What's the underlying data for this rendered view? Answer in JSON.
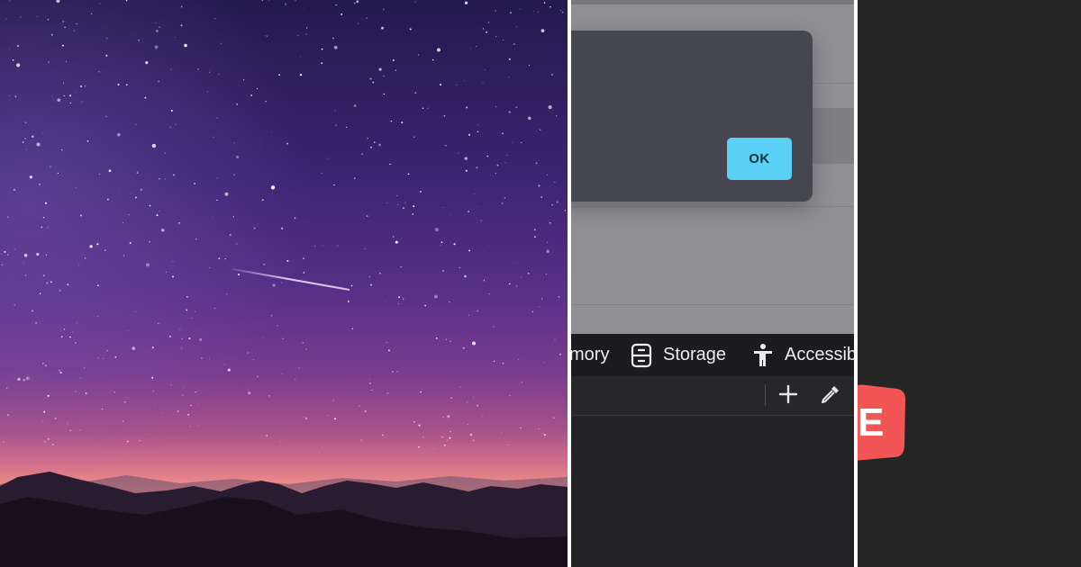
{
  "photo": {
    "description_icon": "night-sky-photo"
  },
  "devtools": {
    "dialog": {
      "ok_label": "OK"
    },
    "tabs": [
      {
        "label": "mory",
        "icon": "memory-icon"
      },
      {
        "label": "Storage",
        "icon": "storage-icon"
      },
      {
        "label": "Accessib",
        "icon": "accessibility-icon"
      }
    ],
    "toolbar": {
      "add_icon": "plus-icon",
      "picker_icon": "eyedropper-icon"
    }
  },
  "right_panel": {
    "logo_letter": "E"
  },
  "colors": {
    "ok_button": "#5ad0f6",
    "dialog": "#46464f",
    "tabbar": "#1c1c1e",
    "logo": "#f25555"
  }
}
